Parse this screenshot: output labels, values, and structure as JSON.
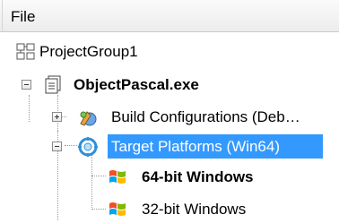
{
  "header": {
    "title": "File"
  },
  "tree": {
    "items": [
      {
        "label": "ProjectGroup1",
        "icon": "project-group-icon"
      },
      {
        "label": "ObjectPascal.exe",
        "icon": "project-file-icon"
      },
      {
        "label": "Build Configurations (Deb…",
        "icon": "build-config-icon"
      },
      {
        "label": "Target Platforms (Win64)",
        "icon": "target-platform-icon",
        "selected": true
      },
      {
        "label": "64-bit Windows",
        "icon": "windows-flag-icon"
      },
      {
        "label": "32-bit Windows",
        "icon": "windows-flag-icon"
      }
    ]
  },
  "colors": {
    "selection": "#3399ff"
  }
}
